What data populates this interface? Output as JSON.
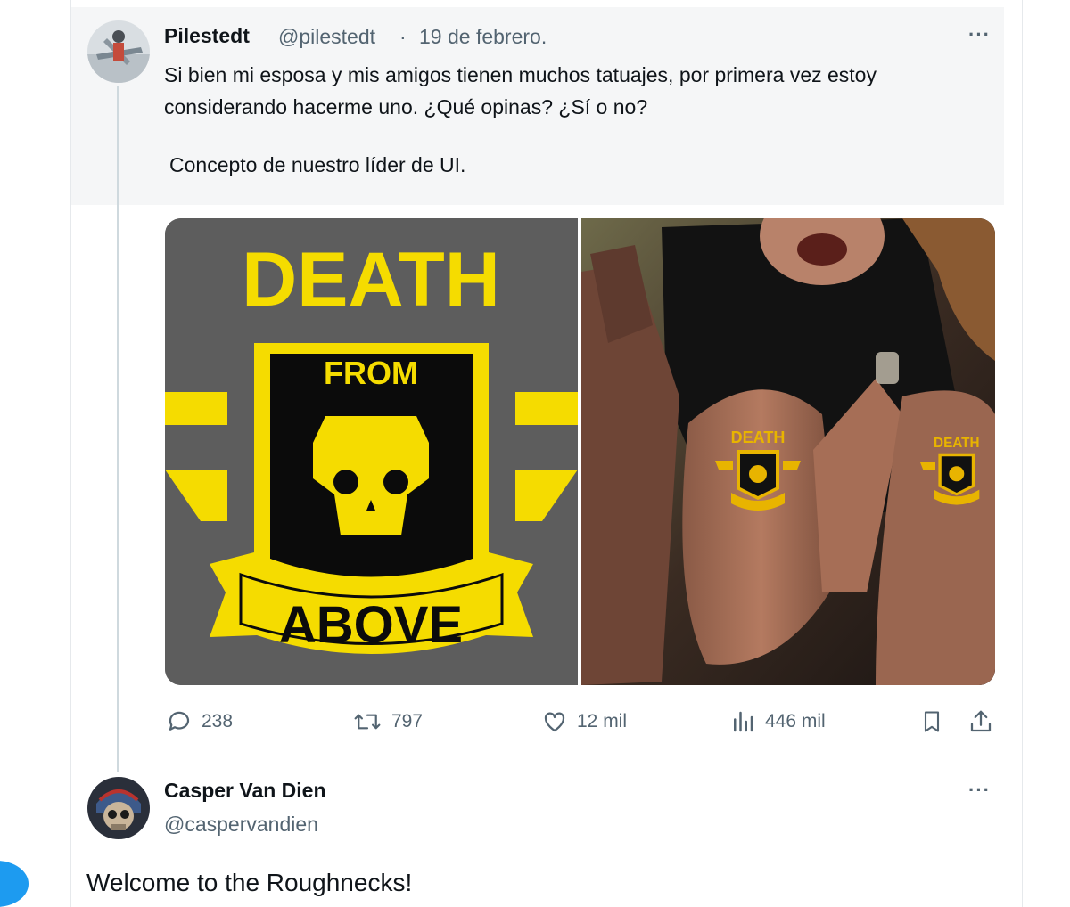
{
  "quoted_tweet": {
    "author_name": "Pilestedt",
    "author_handle": "@pilestedt",
    "separator": "·",
    "date": "19 de febrero.",
    "text": "Si bien mi esposa y mis amigos tienen muchos tatuajes, por primera vez estoy considerando hacerme uno.  ¿Qué opinas?  ¿Sí o no?",
    "text2": "Concepto de nuestro líder de UI.",
    "more_label": "···",
    "media": {
      "logo_text_top": "DEATH",
      "logo_text_middle": "FROM",
      "logo_text_bottom": "ABOVE",
      "logo_colors": {
        "yellow": "#f5dc00",
        "black": "#0b0b0b",
        "grey": "#5d5d5d"
      }
    },
    "actions": {
      "replies": "238",
      "reposts": "797",
      "likes": "12 mil",
      "views": "446 mil"
    }
  },
  "reply_tweet": {
    "author_name": "Casper Van Dien",
    "author_handle": "@caspervandien",
    "more_label": "···",
    "text": "Welcome to the Roughnecks!"
  },
  "icons": [
    "reply-icon",
    "repost-icon",
    "like-icon",
    "views-icon",
    "bookmark-icon",
    "share-icon",
    "more-icon"
  ],
  "colors": {
    "secondary_text": "#536471",
    "primary_text": "#0f1419",
    "accent": "#1d9bf0"
  }
}
